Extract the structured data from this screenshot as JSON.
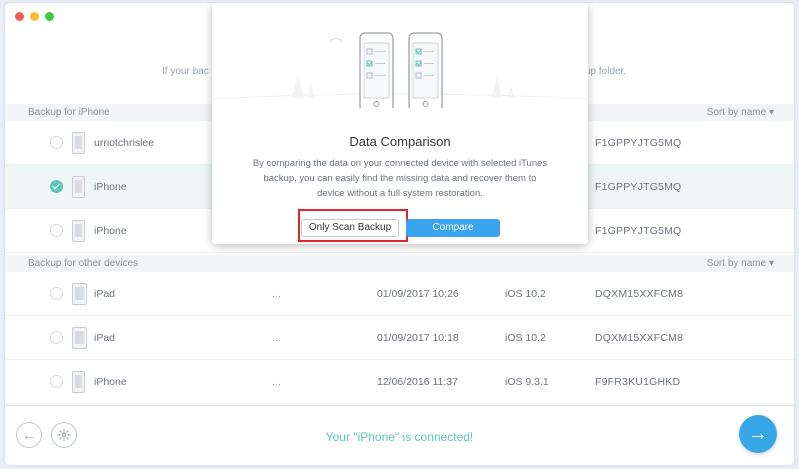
{
  "hint": {
    "left": "If your bac",
    "right": "ckup folder."
  },
  "sections": {
    "iphone": {
      "title": "Backup for iPhone",
      "sort": "Sort by name"
    },
    "other": {
      "title": "Backup for other devices",
      "sort": "Sort by name"
    }
  },
  "rows": [
    {
      "name": "urnotchrislee",
      "serial": "F1GPPYJTG5MQ"
    },
    {
      "name": "iPhone",
      "serial": "F1GPPYJTG5MQ"
    },
    {
      "name": "iPhone",
      "serial": "F1GPPYJTG5MQ"
    },
    {
      "name": "iPad",
      "dots": "...",
      "date": "01/09/2017 10:26",
      "ios": "iOS 10.2",
      "serial": "DQXM15XXFCM8"
    },
    {
      "name": "iPad",
      "dots": "...",
      "date": "01/09/2017 10:18",
      "ios": "iOS 10.2",
      "serial": "DQXM15XXFCM8"
    },
    {
      "name": "iPhone",
      "dots": "...",
      "date": "12/06/2016 11:37",
      "ios": "iOS 9.3.1",
      "serial": "F9FR3KU1GHKD"
    }
  ],
  "selected_row": 1,
  "footer": {
    "status": "Your \"iPhone\" is connected!"
  },
  "modal": {
    "title": "Data Comparison",
    "description": "By comparing the data on your connected device with selected iTunes backup, you can easily find the missing data and recover them to device without a full system restoration.",
    "scan_button": "Only Scan Backup",
    "compare_button": "Compare"
  },
  "icons": {
    "back": "arrow-left-icon",
    "settings": "gear-icon",
    "next": "arrow-right-icon"
  },
  "colors": {
    "accent": "#5cc6b7",
    "primary": "#3aa3ef",
    "highlight": "#e3252d"
  }
}
